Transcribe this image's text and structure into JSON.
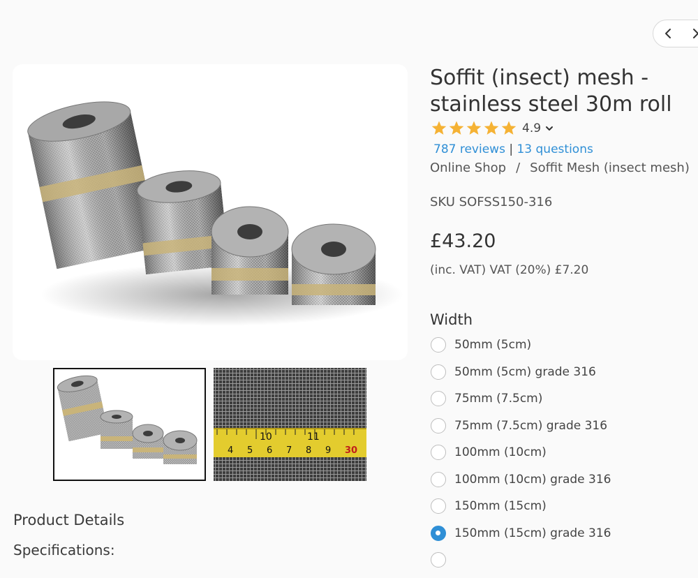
{
  "nav": {
    "prev_icon": "chevron-left-icon",
    "next_icon": "chevron-right-icon"
  },
  "product": {
    "title": "Soffit (insect) mesh - stainless steel 30m roll",
    "rating": {
      "stars": 5,
      "value": "4.9",
      "star_color": "#f5b234"
    },
    "reviews_link": "787 reviews",
    "separator": "|",
    "questions_link": "13 questions",
    "breadcrumb": [
      {
        "label": "Online Shop"
      },
      {
        "label": "Soffit Mesh (insect mesh)"
      }
    ],
    "breadcrumb_separator": "/",
    "sku": "SKU SOFSS150-316",
    "price": "£43.20",
    "vat_text": "(inc. VAT) VAT (20%) £7.20",
    "accent_color": "#2f8fd6"
  },
  "options": {
    "label": "Width",
    "items": [
      {
        "label": "50mm (5cm)",
        "selected": false
      },
      {
        "label": "50mm (5cm) grade 316",
        "selected": false
      },
      {
        "label": "75mm (7.5cm)",
        "selected": false
      },
      {
        "label": "75mm (7.5cm) grade 316",
        "selected": false
      },
      {
        "label": "100mm (10cm)",
        "selected": false
      },
      {
        "label": "100mm (10cm) grade 316",
        "selected": false
      },
      {
        "label": "150mm (15cm)",
        "selected": false
      },
      {
        "label": "150mm (15cm) grade 316",
        "selected": true
      },
      {
        "label": "",
        "selected": false
      }
    ]
  },
  "details": {
    "title": "Product Details",
    "specs_label": "Specifications:"
  },
  "ruler": {
    "major": [
      "10",
      "11"
    ],
    "minor": [
      "4",
      "5",
      "6",
      "7",
      "8",
      "9"
    ],
    "end": "30"
  }
}
